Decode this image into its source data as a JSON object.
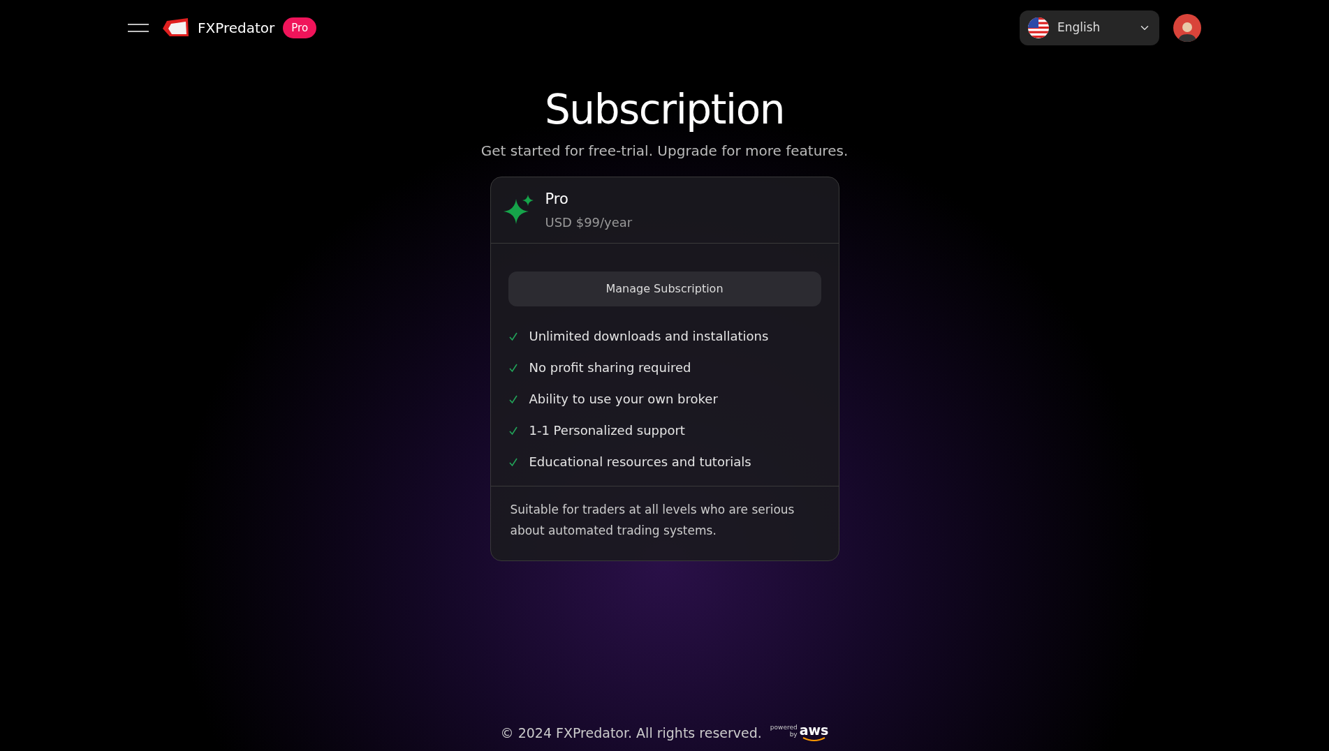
{
  "header": {
    "brand": "FXPredator",
    "plan_badge": "Pro",
    "language": {
      "label": "English"
    }
  },
  "page": {
    "title": "Subscription",
    "subtitle": "Get started for free-trial. Upgrade for more features."
  },
  "plan": {
    "name": "Pro",
    "price": "USD $99/year",
    "button": "Manage Subscription",
    "features": [
      {
        "label": "Unlimited downloads and installations",
        "included": true
      },
      {
        "label": "No profit sharing required",
        "included": true
      },
      {
        "label": "Ability to use your own broker",
        "included": true
      },
      {
        "label": "1-1 Personalized support",
        "included": true
      },
      {
        "label": "Educational resources and tutorials",
        "included": true
      }
    ],
    "description": "Suitable for traders at all levels who are serious about automated trading systems."
  },
  "footer": {
    "copyright": "© 2024 FXPredator. All rights reserved.",
    "badge_top": "powered",
    "badge_by": "by",
    "badge_brand": "aws"
  }
}
